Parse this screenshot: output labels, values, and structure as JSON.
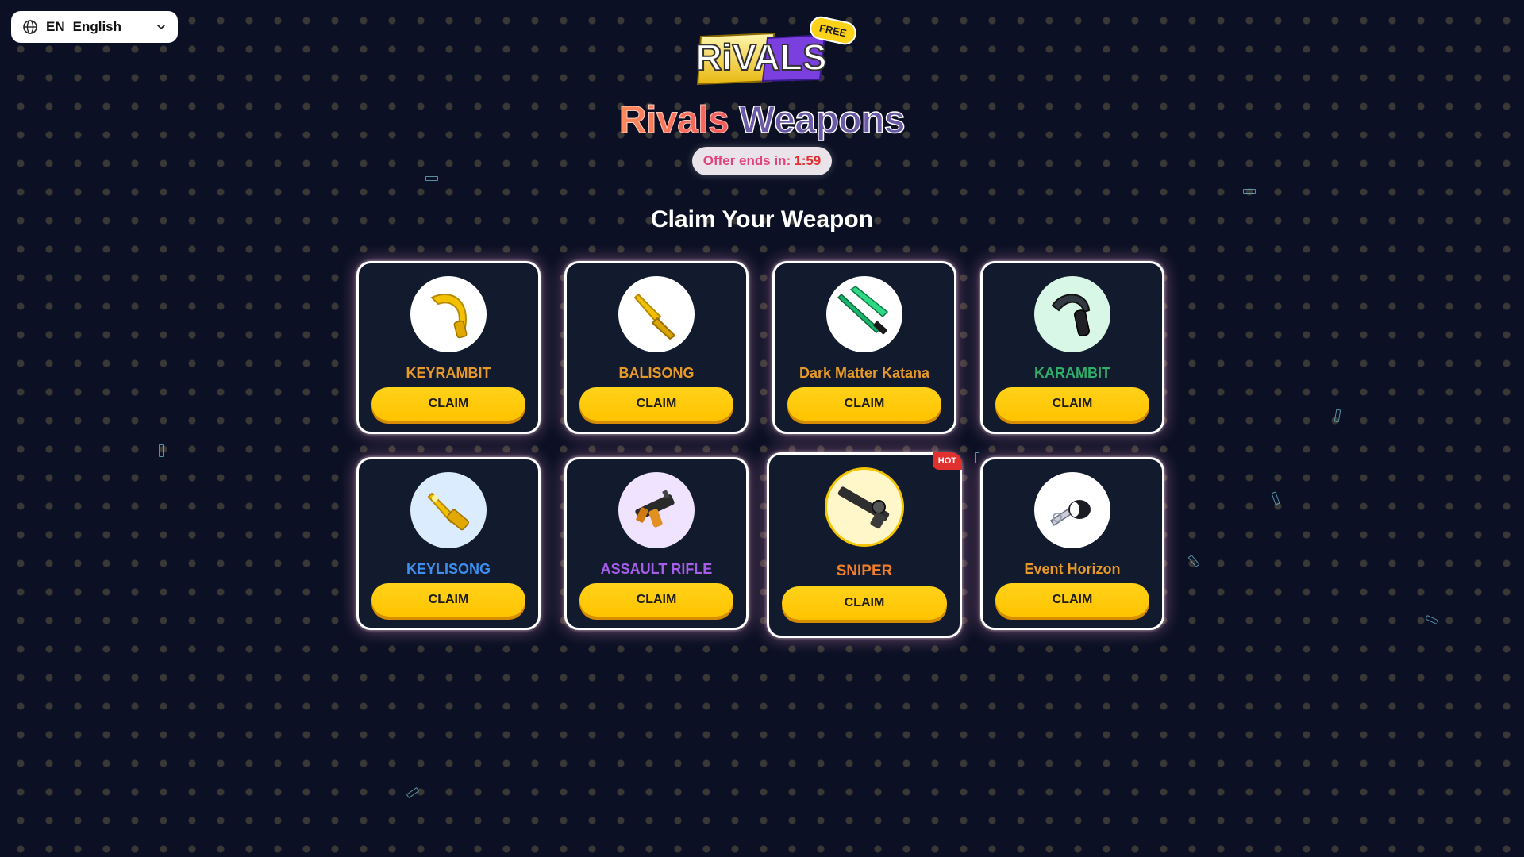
{
  "language": {
    "code": "EN",
    "name": "English",
    "globe_icon": "globe-icon",
    "chevron_icon": "chevron-down-icon"
  },
  "header": {
    "logo_text": "RiVALS",
    "free_badge": "FREE",
    "title_part1": "Rivals",
    "title_part2": "Weapons",
    "offer_label": "Offer ends in:",
    "offer_time": "1:59",
    "subtitle": "Claim Your Weapon"
  },
  "cards": [
    {
      "name": "KEYRAMBIT",
      "name_color": "#e89a28",
      "button": "CLAIM",
      "icon": "gold-claw-knife-icon",
      "bg": "#ffffff"
    },
    {
      "name": "BALISONG",
      "name_color": "#e89a28",
      "button": "CLAIM",
      "icon": "gold-balisong-icon",
      "bg": "#ffffff"
    },
    {
      "name": "Dark Matter Katana",
      "name_color": "#e89a28",
      "button": "CLAIM",
      "icon": "green-katana-icon",
      "bg": "#ffffff"
    },
    {
      "name": "KARAMBIT",
      "name_color": "#2fae6a",
      "button": "CLAIM",
      "icon": "dark-karambit-icon",
      "bg": "#d9f7e6"
    },
    {
      "name": "KEYLISONG",
      "name_color": "#3d8ef0",
      "button": "CLAIM",
      "icon": "gold-key-knife-icon",
      "bg": "#dcecff"
    },
    {
      "name": "ASSAULT RIFLE",
      "name_color": "#a55ee8",
      "button": "CLAIM",
      "icon": "assault-rifle-icon",
      "bg": "#efe3ff"
    },
    {
      "name": "SNIPER",
      "name_color": "#f07f2a",
      "button": "CLAIM",
      "icon": "sniper-rifle-icon",
      "bg": "#fff6c9",
      "badge": "HOT"
    },
    {
      "name": "Event Horizon",
      "name_color": "#e89a28",
      "button": "CLAIM",
      "icon": "event-horizon-icon",
      "bg": "#ffffff"
    }
  ],
  "colors": {
    "background": "#0b1024",
    "card_bg": "#121a2d",
    "claim_button": "#ffc300",
    "hot_badge": "#e0312f"
  }
}
